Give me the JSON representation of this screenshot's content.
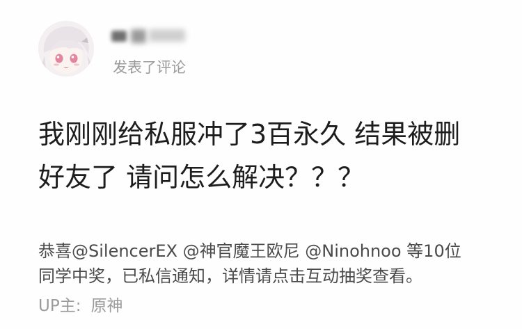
{
  "comment": {
    "action_text": "发表了评论",
    "lines": [
      "我刚刚给私服冲了3百永久 结果被删",
      "好友了 请问怎么解决？？？"
    ]
  },
  "notice": {
    "lines": [
      "恭喜@SilencerEX @神官魔王欧尼 @Ninohnoo 等10位",
      "同学中奖，已私信通知，详情请点击互动抽奖查看。"
    ]
  },
  "up": {
    "label": "UP主:",
    "name": "原神"
  },
  "icons": {
    "avatar": "anime-avatar"
  }
}
